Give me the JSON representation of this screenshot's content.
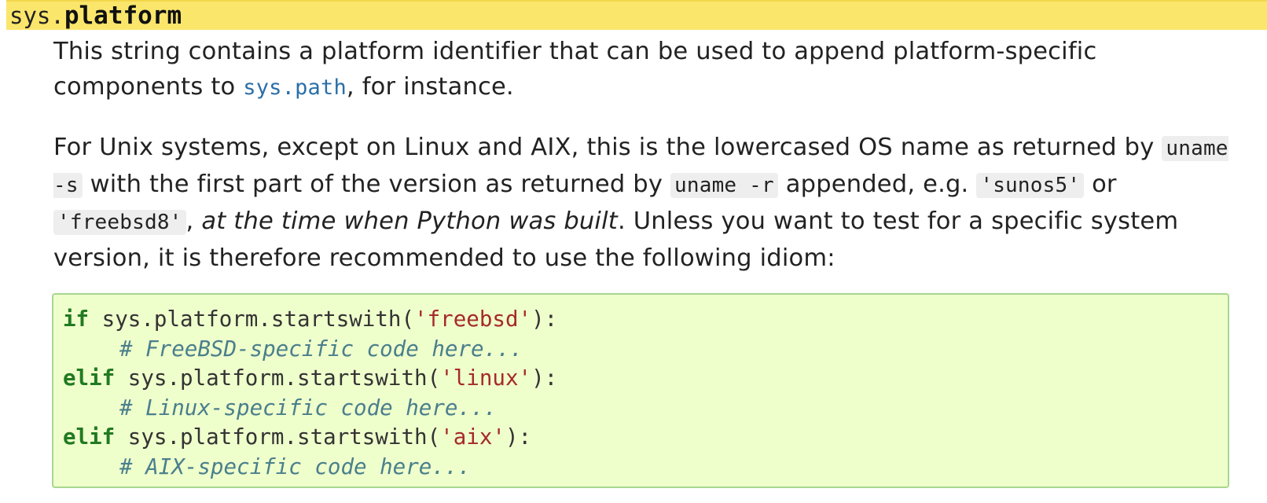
{
  "signature": {
    "prefix": "sys.",
    "name": "platform"
  },
  "description": {
    "para1": {
      "text_before": "This string contains a platform identifier that can be used to append platform-specific components to ",
      "link": "sys.path",
      "text_after": ", for instance."
    },
    "para2": {
      "t1": "For Unix systems, except on Linux and AIX, this is the lowercased OS name as returned by ",
      "c1": "uname -s",
      "t2": " with the first part of the version as returned by ",
      "c2": "uname -r",
      "t3": " appended, e.g. ",
      "c3": "'sunos5'",
      "t4": " or ",
      "c4": "'freebsd8'",
      "t5": ", ",
      "em": "at the time when Python was built",
      "t6": ". Unless you want to test for a specific system version, it is therefore recommended to use the following idiom:"
    }
  },
  "code": {
    "line1": {
      "kw": "if",
      "expr": " sys.platform.startswith(",
      "str": "'freebsd'",
      "end": "):"
    },
    "line2": {
      "comment": "# FreeBSD-specific code here..."
    },
    "line3": {
      "kw": "elif",
      "expr": " sys.platform.startswith(",
      "str": "'linux'",
      "end": "):"
    },
    "line4": {
      "comment": "# Linux-specific code here..."
    },
    "line5": {
      "kw": "elif",
      "expr": " sys.platform.startswith(",
      "str": "'aix'",
      "end": "):"
    },
    "line6": {
      "comment": "# AIX-specific code here..."
    }
  },
  "colors": {
    "signature_bg": "#fbe66c",
    "link": "#2a6fa8",
    "code_bg": "#efffcc",
    "code_border": "#a7d78f",
    "keyword": "#217a21",
    "string": "#a52a2a",
    "comment": "#4a7f8c"
  }
}
